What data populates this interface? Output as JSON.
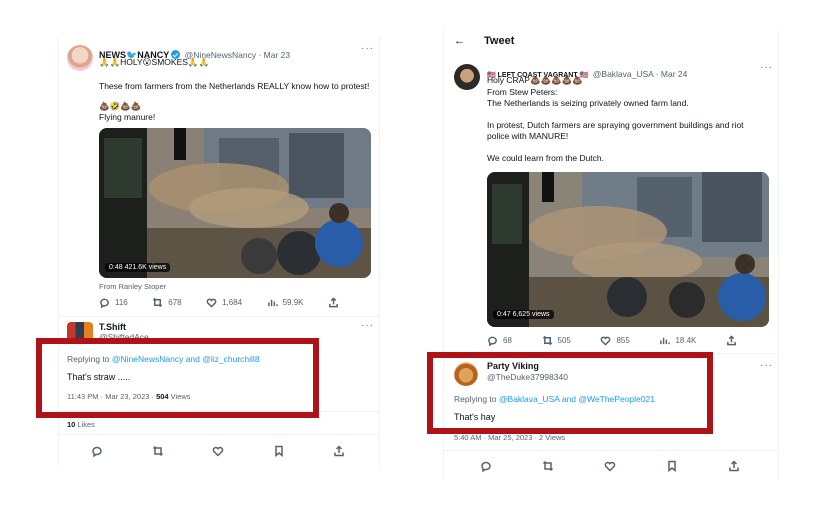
{
  "left": {
    "tweet": {
      "name": "NEWS🐦NANCY",
      "handle": "@NineNewsNancy · Mar 23",
      "line1": "🙏🙏HOLY😮SMOKES🙏🙏",
      "line2": "These from farmers from the Netherlands REALLY know how to protest!",
      "line3": "💩🤣💩💩",
      "line4": "Flying manure!",
      "video_badge": "0:48  421.6K views",
      "video_source": "From Ranley Stoper",
      "reply_count": "116",
      "retweet_count": "678",
      "like_count": "1,684",
      "view_count": "59.9K"
    },
    "reply": {
      "name": "T.Shift",
      "handle": "@ShiftedAce",
      "replying_to_prefix": "Replying to ",
      "replying_to": "@NineNewsNancy and @liz_churchill8",
      "text": "That's straw .....",
      "meta_time": "11:43 PM · Mar 23, 2023 · ",
      "meta_views": "504",
      "meta_views_label": " Views",
      "likes_count": "10",
      "likes_label": " Likes"
    }
  },
  "right": {
    "header_title": "Tweet",
    "tweet": {
      "name": "🇺🇸 LEFT COAST VAGRANT 🇺🇸",
      "handle": "@Baklava_USA · Mar 24",
      "line1": "Holy CRAP💩💩💩💩💩",
      "line2": "From Stew Peters:",
      "line3": "The Netherlands is seizing privately owned farm land.",
      "line4": "In protest, Dutch farmers are spraying government buildings and riot",
      "line5": "police with MANURE!",
      "line6": "We could learn from the Dutch.",
      "video_badge": "0:47  6,625 views",
      "reply_count": "68",
      "retweet_count": "505",
      "like_count": "855",
      "view_count": "18.4K"
    },
    "reply": {
      "name": "Party Viking",
      "handle": "@TheDuke37998340",
      "replying_to_prefix": "Replying to ",
      "replying_to": "@Baklava_USA and @WeThePeople021",
      "text": "That's hay",
      "meta": "5:40 AM · Mar 25, 2023 · 2 Views"
    }
  },
  "colors": {
    "highlight_border": "#b01317",
    "link": "#1d9bf0",
    "muted": "#536471"
  }
}
